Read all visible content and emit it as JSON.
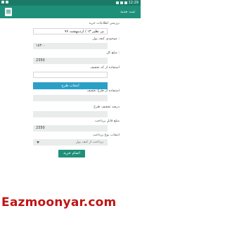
{
  "status_bar": {
    "time": "12:29"
  },
  "app_bar": {
    "title": "ثبت جدید"
  },
  "form": {
    "section_title": "بررسی اطلاعات خرید",
    "date_field": "بی نظیر ۱۳ / اردیبهشت ۹۷",
    "amount_label": "موجودی کیف پول :",
    "amount_value": "۱۸۳۰۰",
    "total_label": "مبلغ کل :",
    "total_value": "2350",
    "discount_label": "استفاده از کد تخفیف",
    "discount_value": "",
    "pick_button": "انتخاب طرح",
    "plan_label": "استفاده از طرح تخفیف",
    "plan_value": "",
    "plan_discount_label": "درصد تخفیف طرح",
    "plan_discount_value": "",
    "payable_label": "مبلغ قابل پرداخت",
    "payable_value": "2350",
    "payment_type_label": "انتخاب نوع پرداخت",
    "payment_type_value": "پرداخت از کیف پول",
    "submit_label": "اتمام خرید"
  },
  "watermark": "Eazmoonyar.com"
}
